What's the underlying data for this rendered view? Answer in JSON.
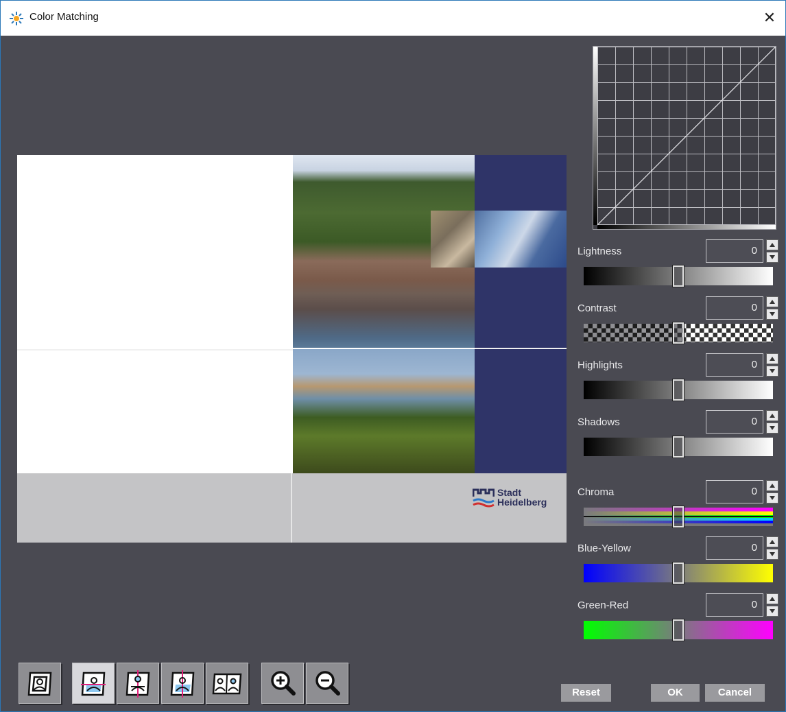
{
  "window": {
    "title": "Color Matching",
    "close_glyph": "✕",
    "icon": "color-sparkle-icon"
  },
  "preview": {
    "logo": {
      "line1": "Stadt",
      "line2": "Heidelberg"
    }
  },
  "controls": [
    {
      "id": "lightness",
      "label": "Lightness",
      "value": "0",
      "fill": 0.5
    },
    {
      "id": "contrast",
      "label": "Contrast",
      "value": "0",
      "fill": 0.5
    },
    {
      "id": "highlights",
      "label": "Highlights",
      "value": "0",
      "fill": 0.5
    },
    {
      "id": "shadows",
      "label": "Shadows",
      "value": "0",
      "fill": 0.5
    },
    {
      "id": "chroma",
      "label": "Chroma",
      "value": "0",
      "fill": 0.5
    },
    {
      "id": "blue-yellow",
      "label": "Blue-Yellow",
      "value": "0",
      "fill": 0.5
    },
    {
      "id": "green-red",
      "label": "Green-Red",
      "value": "0",
      "fill": 0.5
    }
  ],
  "toolbar": {
    "icons": [
      "single-view-icon",
      "split-horizontal-icon",
      "split-vertical-icon",
      "split-quad-icon",
      "side-by-side-icon",
      "zoom-in-icon",
      "zoom-out-icon"
    ]
  },
  "buttons": {
    "reset": "Reset",
    "ok": "OK",
    "cancel": "Cancel"
  },
  "colors": {
    "background": "#4a4a52",
    "navy": "#2f3468",
    "button": "#9a9a9e"
  }
}
